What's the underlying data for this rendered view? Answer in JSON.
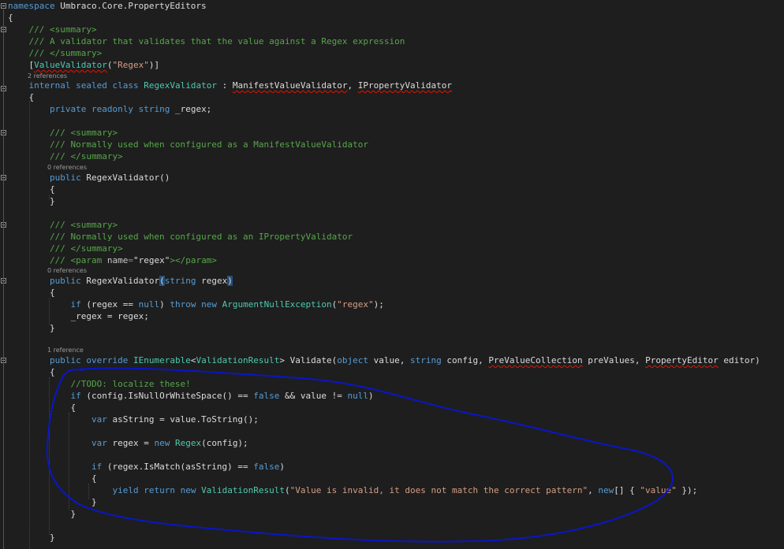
{
  "code": {
    "l1": {
      "a": "namespace",
      "b": " Umbraco.Core.PropertyEditors"
    },
    "l2": "{",
    "l3": "/// <summary>",
    "l4": "/// A validator that validates that the value against a Regex expression",
    "l5": "/// </summary>",
    "l6": {
      "a": "[",
      "b": "ValueValidator",
      "c": "(",
      "d": "\"Regex\"",
      "e": ")]"
    },
    "l7": "2 references",
    "l8": {
      "a": "internal",
      "b": " ",
      "c": "sealed",
      "d": " ",
      "e": "class",
      "f": " ",
      "g": "RegexValidator",
      "h": " : ",
      "i": "ManifestValueValidator",
      "j": ", ",
      "k": "IPropertyValidator"
    },
    "l9": "{",
    "l10": {
      "a": "private",
      "b": " ",
      "c": "readonly",
      "d": " ",
      "e": "string",
      "f": " _regex;"
    },
    "l11": "/// <summary>",
    "l12": "/// Normally used when configured as a ManifestValueValidator",
    "l13": "/// </summary>",
    "l14": "0 references",
    "l15": {
      "a": "public",
      "b": " RegexValidator()"
    },
    "l16": "{",
    "l17": "}",
    "l18": "/// <summary>",
    "l19": "/// Normally used when configured as an IPropertyValidator",
    "l20": "/// </summary>",
    "l21": {
      "a": "/// <param ",
      "b": "name",
      "c": "=",
      "d": "\"regex\"",
      "e": "></param>"
    },
    "l22": "0 references",
    "l23": {
      "a": "public",
      "b": " RegexValidator",
      "c": "(",
      "d": "string",
      "e": " regex",
      "f": ")"
    },
    "l24": "{",
    "l25": {
      "a": "if",
      "b": " (regex == ",
      "c": "null",
      "d": ") ",
      "e": "throw",
      "f": " ",
      "g": "new",
      "h": " ",
      "i": "ArgumentNullException",
      "j": "(",
      "k": "\"regex\"",
      "l": ");"
    },
    "l26": "_regex = regex;",
    "l27": "}",
    "l28": "1 reference",
    "l29": {
      "a": "public",
      "b": " ",
      "c": "override",
      "d": " ",
      "e": "IEnumerable",
      "f": "<",
      "g": "ValidationResult",
      "h": "> ",
      "i": "Validate",
      "j": "(",
      "k": "object",
      "l": " value, ",
      "m": "string",
      "n": " config, ",
      "o": "PreValueCollection",
      "p": " preValues, ",
      "q": "PropertyEditor",
      "r": " editor)"
    },
    "l30": "{",
    "l31": "//TODO: localize these!",
    "l32": {
      "a": "if",
      "b": " (config.IsNullOrWhiteSpace() == ",
      "c": "false",
      "d": " && value != ",
      "e": "null",
      "f": ")"
    },
    "l33": "{",
    "l34": {
      "a": "var",
      "b": " asString = value.ToString();"
    },
    "l35": {
      "a": "var",
      "b": " regex = ",
      "c": "new",
      "d": " ",
      "e": "Regex",
      "f": "(config);"
    },
    "l36": {
      "a": "if",
      "b": " (regex.IsMatch(asString) == ",
      "c": "false",
      "d": ")"
    },
    "l37": "{",
    "l38": {
      "a": "yield",
      "b": " ",
      "c": "return",
      "d": " ",
      "e": "new",
      "f": " ",
      "g": "ValidationResult",
      "h": "(",
      "i": "\"Value is invalid, it does not match the correct pattern\"",
      "j": ", ",
      "k": "new",
      "l": "[] { ",
      "m": "\"value\"",
      "n": " });"
    },
    "l39": "}",
    "l40": "}",
    "l41": "}"
  },
  "annotation_color": "#0a16c8"
}
